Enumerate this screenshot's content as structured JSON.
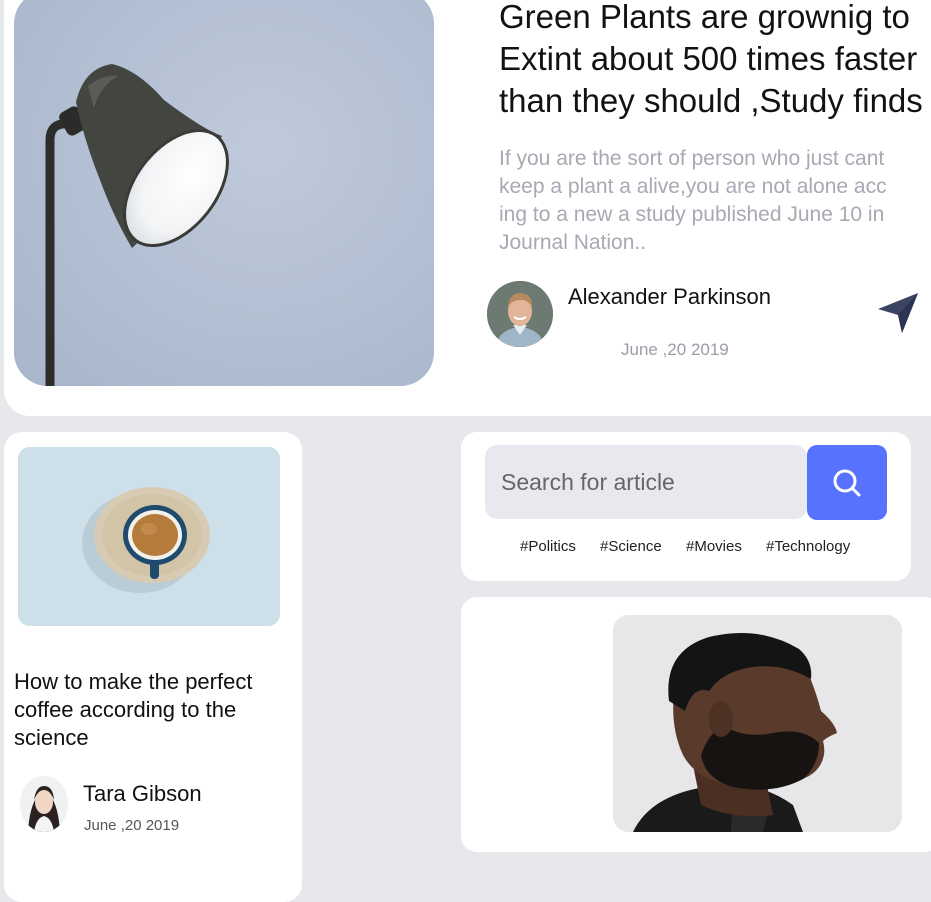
{
  "featured": {
    "title_lines": [
      "Green Plants are grownig to",
      "Extint about 500 times faster",
      "than they should ,Study finds"
    ],
    "excerpt_lines": [
      "If you are the sort of person who just cant",
      "keep a plant a alive,you are not alone acc",
      "ing to a new a study published June 10 in",
      "Journal Nation.."
    ],
    "author": "Alexander Parkinson",
    "date": "June ,20 2019",
    "share_icon": "paper-plane-icon"
  },
  "coffee": {
    "title_lines": [
      "How to make the perfect",
      "coffee according to the",
      "science"
    ],
    "author": "Tara Gibson",
    "date": "June ,20 2019"
  },
  "search": {
    "placeholder": "Search for article",
    "button_icon": "search-icon",
    "tags": [
      "#Politics",
      "#Science",
      "#Movies",
      "#Technology"
    ]
  },
  "colors": {
    "accent": "#5672ff",
    "background": "#e7e8ec",
    "card": "#ffffff",
    "muted_text": "#a7a9b3",
    "share_icon": "#3a4463"
  }
}
